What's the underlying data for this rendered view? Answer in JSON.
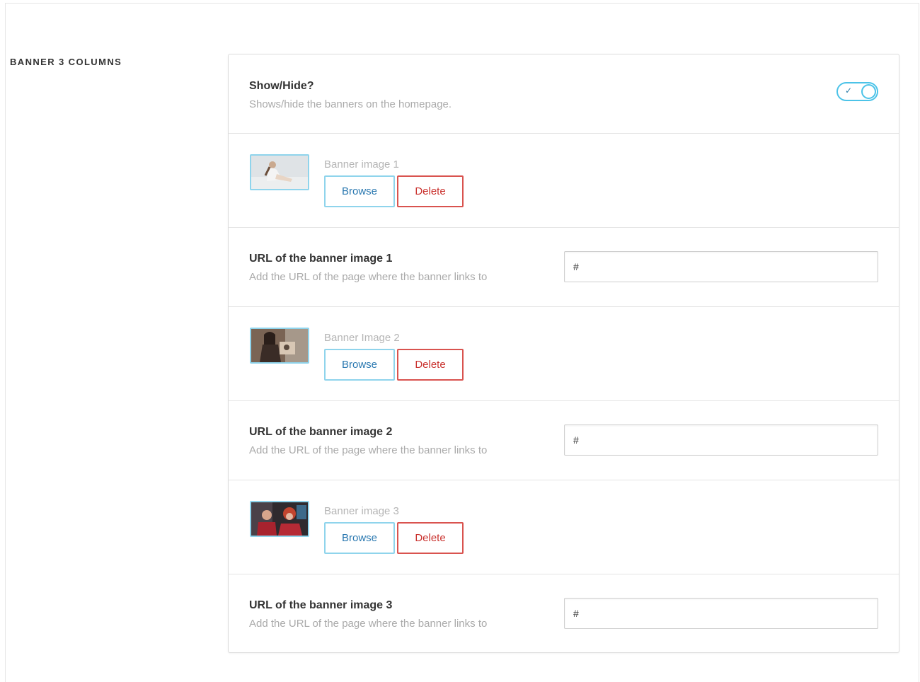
{
  "section": {
    "title": "BANNER 3 COLUMNS"
  },
  "show_hide": {
    "title": "Show/Hide?",
    "description": "Shows/hide the banners on the homepage.",
    "toggle_on": true,
    "check_glyph": "✓"
  },
  "banners": [
    {
      "image_label": "Banner image 1",
      "browse_label": "Browse",
      "delete_label": "Delete",
      "url_title": "URL of the banner image 1",
      "url_description": "Add the URL of the page where the banner links to",
      "url_value": "#"
    },
    {
      "image_label": "Banner Image 2",
      "browse_label": "Browse",
      "delete_label": "Delete",
      "url_title": "URL of the banner image 2",
      "url_description": "Add the URL of the page where the banner links to",
      "url_value": "#"
    },
    {
      "image_label": "Banner image 3",
      "browse_label": "Browse",
      "delete_label": "Delete",
      "url_title": "URL of the banner image 3",
      "url_description": "Add the URL of the page where the banner links to",
      "url_value": "#"
    }
  ],
  "colors": {
    "accent": "#4cc3e8",
    "browse_text": "#2a78b0",
    "delete": "#d9534f"
  }
}
